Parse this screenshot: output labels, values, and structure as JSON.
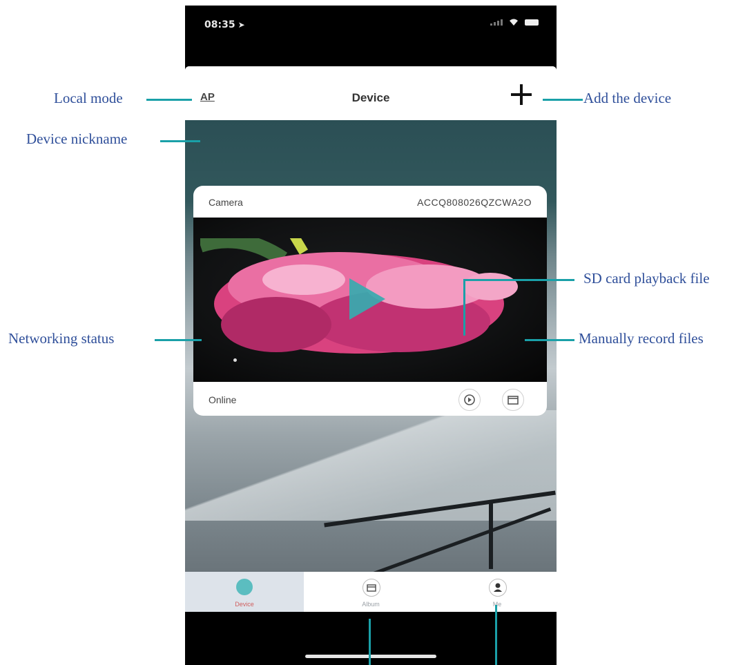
{
  "status_bar": {
    "time": "08:35",
    "location_arrow": "➤"
  },
  "nav": {
    "left": "AP",
    "title": "Device",
    "add_icon": "plus-icon"
  },
  "device_card": {
    "nickname": "Camera",
    "device_id": "ACCQ808026QZCWA2O",
    "status": "Online",
    "preview_icon": "play-icon",
    "actions": [
      {
        "name": "sd-playback",
        "icon": "playback-icon"
      },
      {
        "name": "record-files",
        "icon": "folder-icon"
      }
    ]
  },
  "tabs": [
    {
      "label": "Device",
      "icon": "camera-icon",
      "active": true
    },
    {
      "label": "Album",
      "icon": "folder-icon",
      "active": false
    },
    {
      "label": "Me",
      "icon": "person-icon",
      "active": false
    }
  ],
  "annotations": {
    "local_mode": "Local mode",
    "add_device": "Add the device",
    "device_nickname": "Device nickname",
    "sd_playback": "SD card playback file",
    "networking_status": "Networking status",
    "manual_record": "Manually record files"
  },
  "colors": {
    "accent": "#37aaaf",
    "annotation_text": "#2f4f9a",
    "leader_line": "#1aa0a8",
    "active_tab": "#dde3ea"
  }
}
